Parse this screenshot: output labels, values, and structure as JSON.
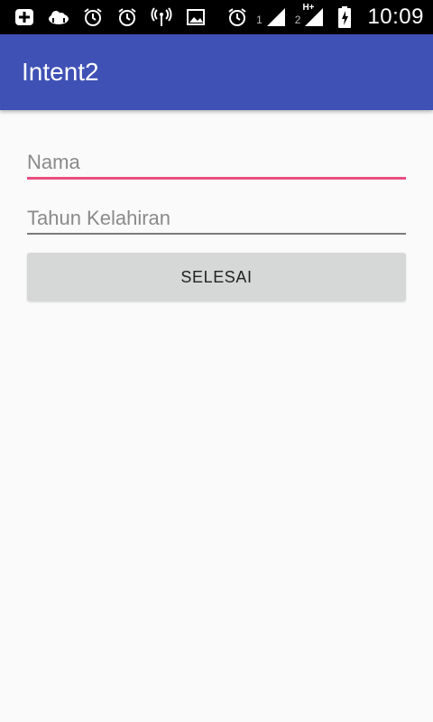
{
  "status_bar": {
    "time": "10:09",
    "sim1_label": "1",
    "sim2_label": "2",
    "network_type": "H+",
    "icons_left": [
      "battery-plus-icon",
      "cloud-sync-icon",
      "alarm-icon",
      "alarm-icon",
      "wifi-tower-icon",
      "image-icon"
    ],
    "icons_right": [
      "alarm-icon",
      "signal-icon",
      "signal-icon",
      "battery-charging-icon"
    ]
  },
  "app_bar": {
    "title": "Intent2",
    "color": "#3f51b5"
  },
  "form": {
    "name_placeholder": "Nama",
    "birth_year_placeholder": "Tahun Kelahiran",
    "submit_label": "SELESAI",
    "focus_color": "#e94e7f"
  }
}
